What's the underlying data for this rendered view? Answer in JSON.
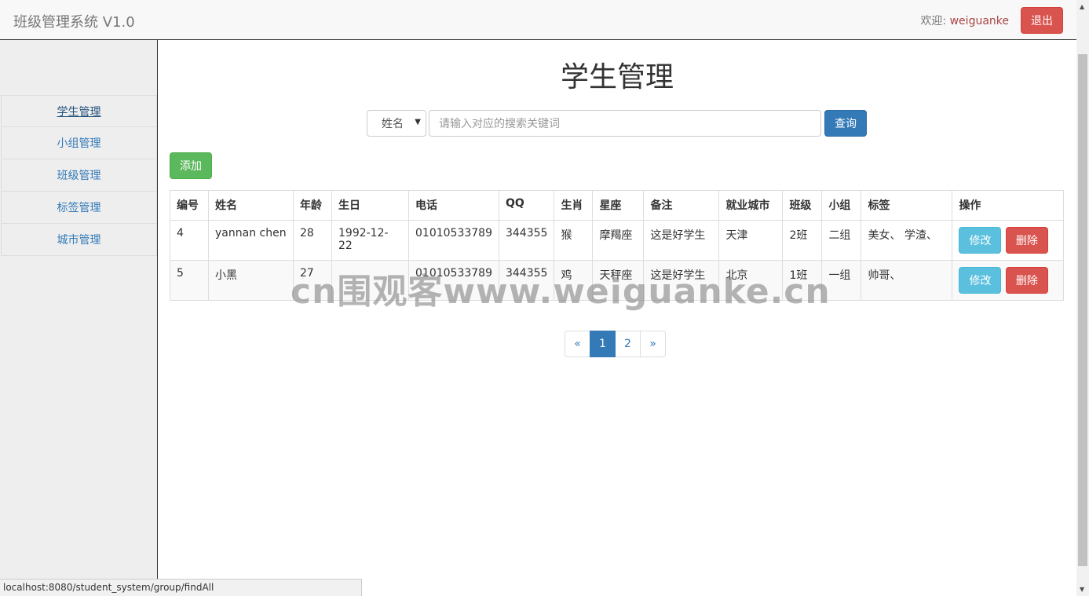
{
  "navbar": {
    "brand": "班级管理系统 V1.0",
    "welcome_prefix": "欢迎: ",
    "username": "weiguanke",
    "logout_label": "退出"
  },
  "sidebar": {
    "items": [
      {
        "label": "学生管理",
        "active": true
      },
      {
        "label": "小组管理"
      },
      {
        "label": "班级管理"
      },
      {
        "label": "标签管理"
      },
      {
        "label": "城市管理"
      }
    ]
  },
  "main": {
    "title": "学生管理",
    "search": {
      "field_selected": "姓名",
      "placeholder": "请输入对应的搜索关键词",
      "button_label": "查询"
    },
    "add_label": "添加",
    "table": {
      "headers": [
        "编号",
        "姓名",
        "年龄",
        "生日",
        "电话",
        "QQ",
        "生肖",
        "星座",
        "备注",
        "就业城市",
        "班级",
        "小组",
        "标签",
        "操作"
      ],
      "rows": [
        {
          "id": "4",
          "name": "yannan chen",
          "age": "28",
          "birthday": "1992-12-22",
          "phone": "01010533789",
          "qq": "344355",
          "zodiac": "猴",
          "constellation": "摩羯座",
          "note": "这是好学生",
          "city": "天津",
          "class": "2班",
          "group": "二组",
          "tags": "美女、 学渣、",
          "edit_label": "修改",
          "delete_label": "删除"
        },
        {
          "id": "5",
          "name": "小黑",
          "age": "27",
          "birthday": "",
          "phone": "01010533789",
          "qq": "344355",
          "zodiac": "鸡",
          "constellation": "天秤座",
          "note": "这是好学生",
          "city": "北京",
          "class": "1班",
          "group": "一组",
          "tags": "帅哥、",
          "edit_label": "修改",
          "delete_label": "删除"
        }
      ]
    },
    "pagination": {
      "prev": "«",
      "pages": [
        "1",
        "2"
      ],
      "current": "1",
      "next": "»"
    }
  },
  "watermark": "cn围观客www.weiguanke.cn",
  "statusbar": "localhost:8080/student_system/group/findAll",
  "colors": {
    "primary": "#337ab7",
    "danger": "#d9534f",
    "success": "#5cb85c",
    "info": "#5bc0de"
  }
}
